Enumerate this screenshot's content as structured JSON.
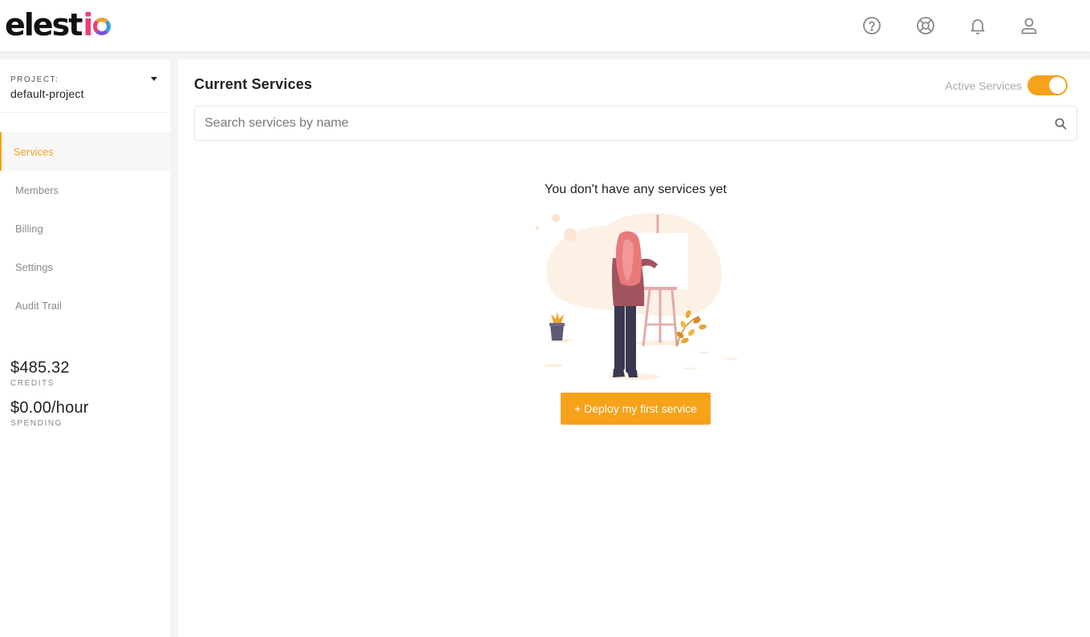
{
  "brand": {
    "logo_prefix": "eles",
    "logo_t": "t",
    "logo_i": "i"
  },
  "topbar": {
    "icons": [
      "help-circle-icon",
      "lifebuoy-icon",
      "bell-icon",
      "user-icon"
    ]
  },
  "sidebar": {
    "project_label": "PROJECT:",
    "project_name": "default-project",
    "nav": [
      {
        "label": "Services",
        "active": true
      },
      {
        "label": "Members",
        "active": false
      },
      {
        "label": "Billing",
        "active": false
      },
      {
        "label": "Settings",
        "active": false
      },
      {
        "label": "Audit Trail",
        "active": false
      }
    ],
    "credits_value": "$485.32",
    "credits_label": "CREDITS",
    "spending_value": "$0.00/hour",
    "spending_label": "SPENDING"
  },
  "main": {
    "title": "Current Services",
    "active_toggle_label": "Active Services",
    "active_toggle_on": true,
    "search_placeholder": "Search services by name",
    "search_value": "",
    "empty_message": "You don't have any services yet",
    "deploy_button": "+ Deploy my first service"
  },
  "colors": {
    "accent": "#f7a21b",
    "text": "#222222",
    "muted": "#8a8a8a"
  }
}
